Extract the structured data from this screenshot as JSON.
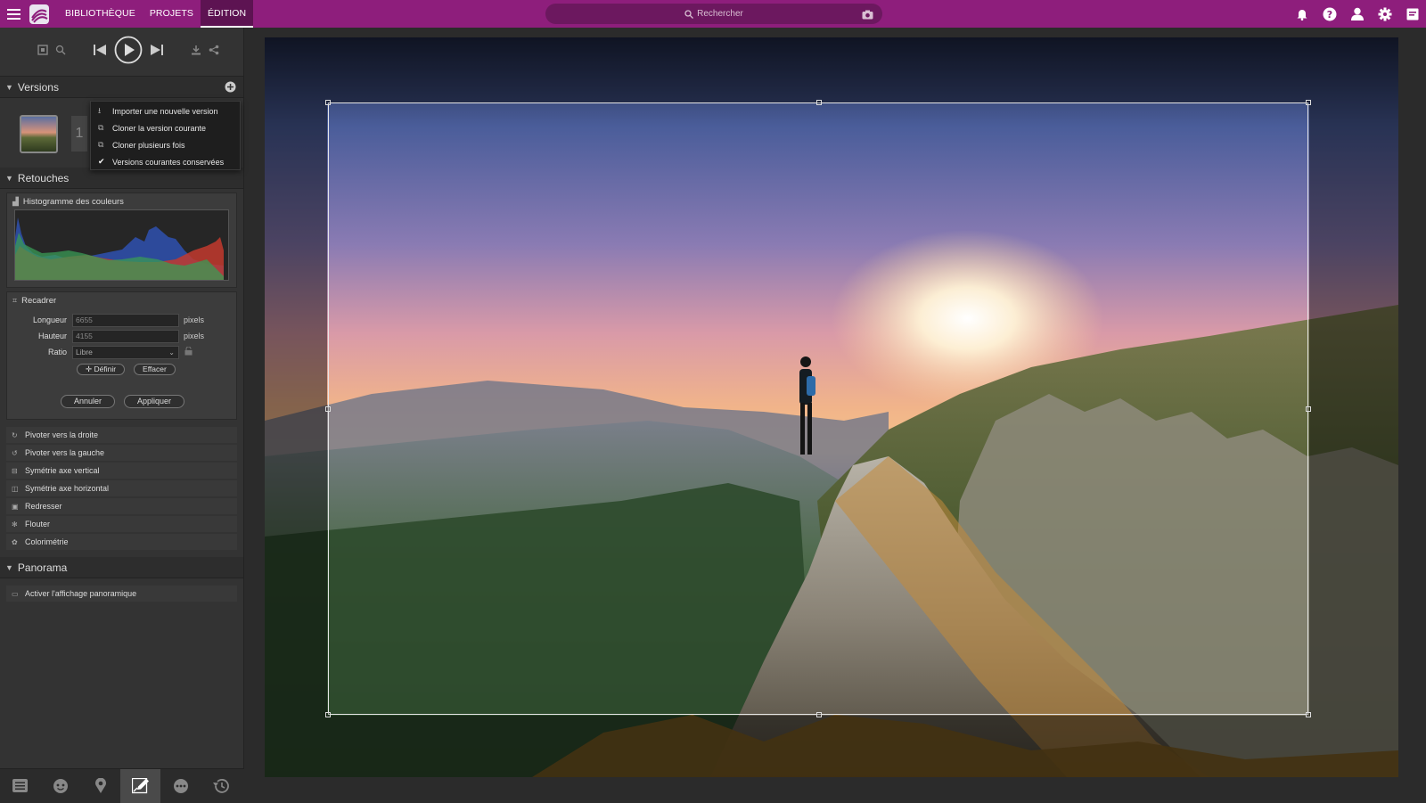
{
  "app": {
    "nav": [
      "BIBLIOTHÈQUE",
      "PROJETS",
      "ÉDITION"
    ],
    "active_nav": "ÉDITION",
    "search_placeholder": "Rechercher",
    "brand_color": "#8e1e7c",
    "icons_right": [
      "bell-icon",
      "help-icon",
      "user-icon",
      "gear-icon",
      "panel-icon"
    ]
  },
  "versions": {
    "title": "Versions",
    "current_number": "1",
    "menu": [
      {
        "icon": "upload-icon",
        "label": "Importer une nouvelle version"
      },
      {
        "icon": "copy-icon",
        "label": "Cloner la version courante"
      },
      {
        "icon": "copy-icon",
        "label": "Cloner plusieurs fois"
      },
      {
        "icon": "check-icon",
        "label": "Versions courantes conservées",
        "checked": true
      }
    ]
  },
  "retouches": {
    "title": "Retouches",
    "histogram_title": "Histogramme des couleurs",
    "crop": {
      "title": "Recadrer",
      "length_label": "Longueur",
      "length_value": "6655",
      "height_label": "Hauteur",
      "height_value": "4155",
      "unit": "pixels",
      "ratio_label": "Ratio",
      "ratio_value": "Libre",
      "define_label": "Définir",
      "clear_label": "Effacer",
      "cancel_label": "Annuler",
      "apply_label": "Appliquer"
    },
    "tools": [
      "Pivoter vers la droite",
      "Pivoter vers la gauche",
      "Symétrie axe vertical",
      "Symétrie axe horizontal",
      "Redresser",
      "Flouter",
      "Colorimétrie"
    ]
  },
  "panorama": {
    "title": "Panorama",
    "toggle_label": "Activer l'affichage panoramique"
  }
}
